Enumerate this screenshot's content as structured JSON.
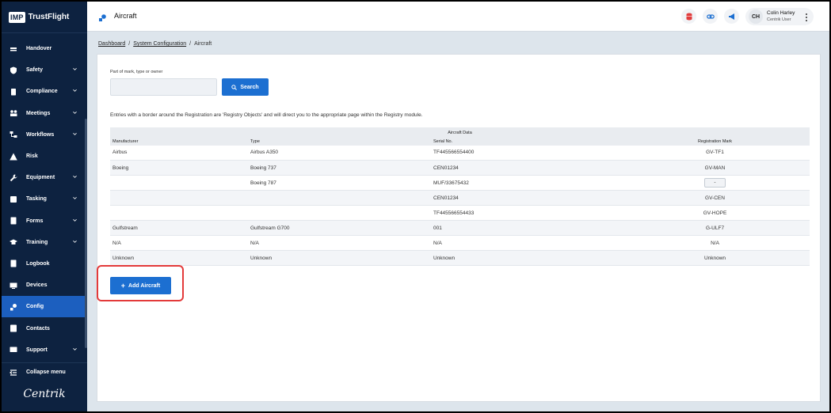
{
  "brand": {
    "logo": "IMP",
    "name": "TrustFlight"
  },
  "sidebar": {
    "items": [
      {
        "label": "Handover",
        "icon": "handover-icon",
        "chevron": false,
        "active": false
      },
      {
        "label": "Safety",
        "icon": "shield-icon",
        "chevron": true,
        "active": false
      },
      {
        "label": "Compliance",
        "icon": "clipboard-icon",
        "chevron": true,
        "active": false
      },
      {
        "label": "Meetings",
        "icon": "people-icon",
        "chevron": true,
        "active": false
      },
      {
        "label": "Workflows",
        "icon": "workflow-icon",
        "chevron": true,
        "active": false
      },
      {
        "label": "Risk",
        "icon": "warning-icon",
        "chevron": false,
        "active": false
      },
      {
        "label": "Equipment",
        "icon": "wrench-icon",
        "chevron": true,
        "active": false
      },
      {
        "label": "Tasking",
        "icon": "tasks-icon",
        "chevron": true,
        "active": false
      },
      {
        "label": "Forms",
        "icon": "forms-icon",
        "chevron": true,
        "active": false
      },
      {
        "label": "Training",
        "icon": "graduation-cap-icon",
        "chevron": true,
        "active": false
      },
      {
        "label": "Logbook",
        "icon": "book-icon",
        "chevron": false,
        "active": false
      },
      {
        "label": "Devices",
        "icon": "devices-icon",
        "chevron": false,
        "active": false
      },
      {
        "label": "Config",
        "icon": "config-icon",
        "chevron": false,
        "active": true
      },
      {
        "label": "Contacts",
        "icon": "contacts-icon",
        "chevron": false,
        "active": false
      },
      {
        "label": "Support",
        "icon": "support-icon",
        "chevron": true,
        "active": false
      }
    ],
    "collapse_label": "Collapse menu",
    "footer_logo": "Centrik"
  },
  "header": {
    "title": "Aircraft",
    "user": {
      "initials": "CH",
      "name": "Colin Harley",
      "role": "Centrik User"
    }
  },
  "breadcrumb": {
    "items": [
      "Dashboard",
      "System Configuration"
    ],
    "current": "Aircraft"
  },
  "search": {
    "label": "Part of mark, type or owner",
    "value": "",
    "placeholder": "",
    "button_label": "Search"
  },
  "info_text": "Entries with a border around the Registration are 'Registry Objects' and will direct you to the appropriate page within the Registry module.",
  "table": {
    "group_header": "Aircraft Data",
    "columns": [
      "Manufacturer",
      "Type",
      "Serial No.",
      "Registration Mark"
    ],
    "rows": [
      {
        "manufacturer": "Airbus",
        "type": "Airbus A350",
        "serial": "TF445566554400",
        "reg": "GV-TF1",
        "registry": false
      },
      {
        "manufacturer": "Boeing",
        "type": "Boeing 737",
        "serial": "CEN01234",
        "reg": "GV-MAN",
        "registry": false
      },
      {
        "manufacturer": "",
        "type": "Boeing 787",
        "serial": "MUF/33675432",
        "reg": "-",
        "registry": true
      },
      {
        "manufacturer": "",
        "type": "",
        "serial": "CEN01234",
        "reg": "GV-CEN",
        "registry": false
      },
      {
        "manufacturer": "",
        "type": "",
        "serial": "TF445566554433",
        "reg": "GV-HOPE",
        "registry": false
      },
      {
        "manufacturer": "Gulfstream",
        "type": "Gulfstream G700",
        "serial": "001",
        "reg": "G-ULF7",
        "registry": false
      },
      {
        "manufacturer": "N/A",
        "type": "N/A",
        "serial": "N/A",
        "reg": "N/A",
        "registry": false
      },
      {
        "manufacturer": "Unknown",
        "type": "Unknown",
        "serial": "Unknown",
        "reg": "Unknown",
        "registry": false
      }
    ]
  },
  "add_button_label": "Add Aircraft",
  "colors": {
    "sidebar": "#0d2240",
    "accent": "#1c6fd1",
    "active": "#1c5fbf",
    "highlight": "#e33a3a"
  }
}
